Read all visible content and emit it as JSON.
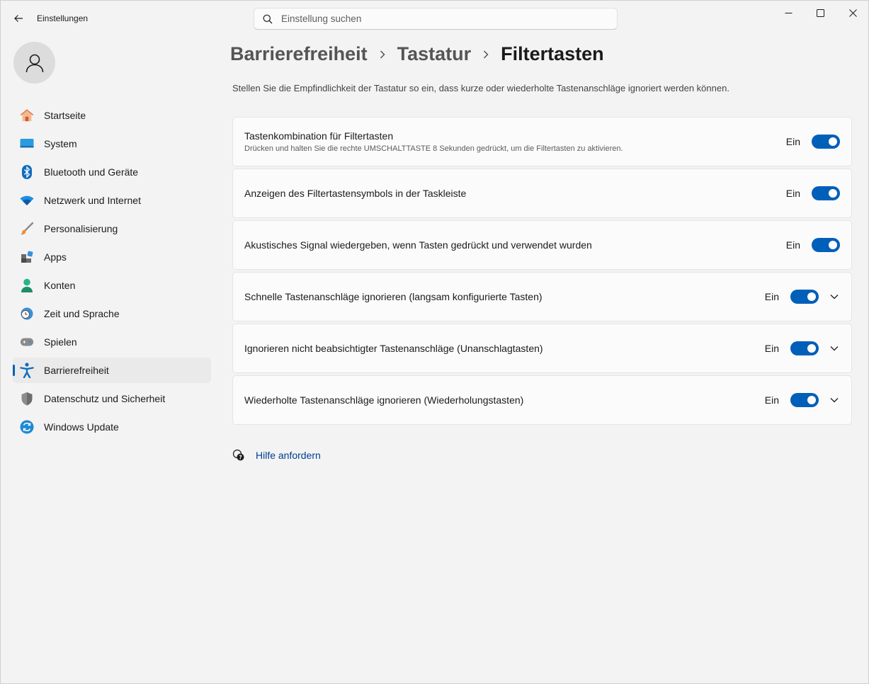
{
  "app": {
    "title": "Einstellungen"
  },
  "search": {
    "placeholder": "Einstellung suchen",
    "value": ""
  },
  "sidebar": {
    "items": [
      {
        "label": "Startseite",
        "icon": "home-icon",
        "active": false
      },
      {
        "label": "System",
        "icon": "system-icon",
        "active": false
      },
      {
        "label": "Bluetooth und Geräte",
        "icon": "bluetooth-icon",
        "active": false
      },
      {
        "label": "Netzwerk und Internet",
        "icon": "wifi-icon",
        "active": false
      },
      {
        "label": "Personalisierung",
        "icon": "brush-icon",
        "active": false
      },
      {
        "label": "Apps",
        "icon": "apps-icon",
        "active": false
      },
      {
        "label": "Konten",
        "icon": "account-icon",
        "active": false
      },
      {
        "label": "Zeit und Sprache",
        "icon": "clock-globe-icon",
        "active": false
      },
      {
        "label": "Spielen",
        "icon": "gamepad-icon",
        "active": false
      },
      {
        "label": "Barrierefreiheit",
        "icon": "accessibility-icon",
        "active": true
      },
      {
        "label": "Datenschutz und Sicherheit",
        "icon": "shield-icon",
        "active": false
      },
      {
        "label": "Windows Update",
        "icon": "update-icon",
        "active": false
      }
    ]
  },
  "breadcrumb": {
    "items": [
      "Barrierefreiheit",
      "Tastatur",
      "Filtertasten"
    ]
  },
  "description": "Stellen Sie die Empfindlichkeit der Tastatur so ein, dass kurze oder wiederholte Tastenanschläge ignoriert werden können.",
  "settings": [
    {
      "title": "Tastenkombination für Filtertasten",
      "subtitle": "Drücken und halten Sie die rechte UMSCHALTTASTE 8 Sekunden gedrückt, um die Filtertasten zu aktivieren.",
      "state": "Ein",
      "on": true,
      "expandable": false
    },
    {
      "title": "Anzeigen des Filtertastensymbols in der Taskleiste",
      "state": "Ein",
      "on": true,
      "expandable": false
    },
    {
      "title": "Akustisches Signal wiedergeben, wenn Tasten gedrückt und verwendet wurden",
      "state": "Ein",
      "on": true,
      "expandable": false
    },
    {
      "title": "Schnelle Tastenanschläge ignorieren (langsam konfigurierte Tasten)",
      "state": "Ein",
      "on": true,
      "expandable": true
    },
    {
      "title": "Ignorieren nicht beabsichtigter Tastenanschläge (Unanschlagtasten)",
      "state": "Ein",
      "on": true,
      "expandable": true
    },
    {
      "title": "Wiederholte Tastenanschläge ignorieren (Wiederholungstasten)",
      "state": "Ein",
      "on": true,
      "expandable": true
    }
  ],
  "help": {
    "label": "Hilfe anfordern",
    "icon": "help-chat-icon"
  },
  "colors": {
    "accent": "#005fb8",
    "background": "#f3f3f3",
    "card": "#fbfbfb",
    "link": "#003e92"
  }
}
